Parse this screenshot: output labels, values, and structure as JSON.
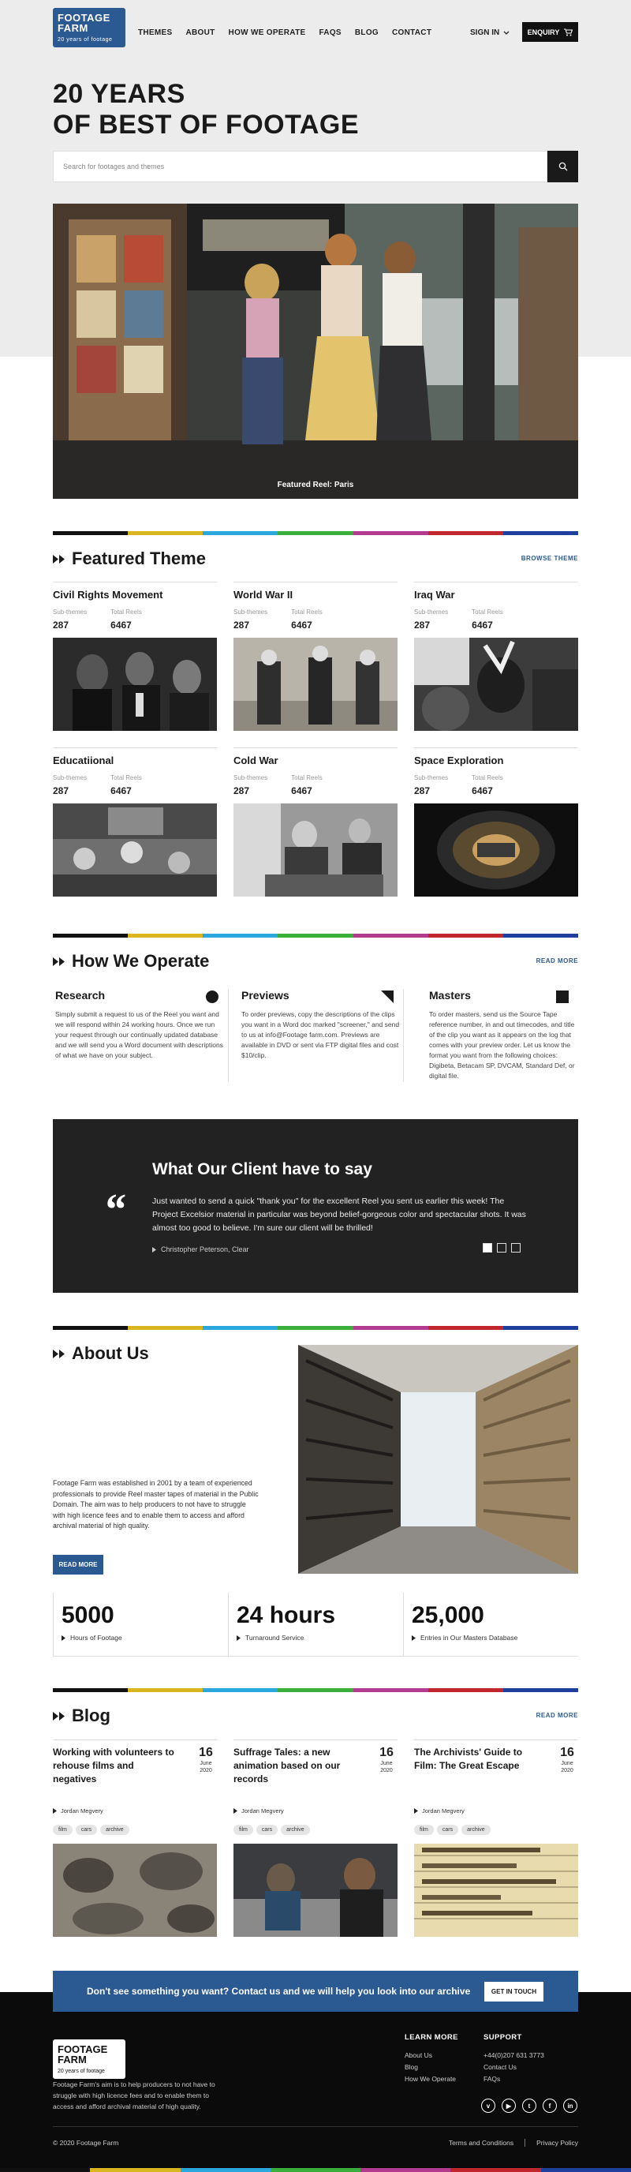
{
  "header": {
    "logo_line1": "FOOTAGE",
    "logo_line2": "FARM",
    "logo_tag": "20 years of footage",
    "nav": [
      "THEMES",
      "ABOUT",
      "HOW WE OPERATE",
      "FAQS",
      "BLOG",
      "CONTACT"
    ],
    "signin": "SIGN IN",
    "enquiry": "ENQUIRY"
  },
  "hero": {
    "title_line1": "20 YEARS",
    "title_line2": "OF BEST OF FOOTAGE",
    "search_placeholder": "Search for footages and themes",
    "caption": "Featured Reel: Paris"
  },
  "stripe_colors": [
    "#111111",
    "#d9b620",
    "#2aa7dd",
    "#3aae3a",
    "#b23a8f",
    "#c0262b",
    "#1f3f9e"
  ],
  "featured": {
    "title": "Featured Theme",
    "link": "BROWSE THEME",
    "sub_label": "Sub-themes",
    "reels_label": "Total Reels",
    "themes": [
      {
        "name": "Civil Rights Movement",
        "sub": "287",
        "reels": "6467"
      },
      {
        "name": "World War II",
        "sub": "287",
        "reels": "6467"
      },
      {
        "name": "Iraq War",
        "sub": "287",
        "reels": "6467"
      },
      {
        "name": "Educatiional",
        "sub": "287",
        "reels": "6467"
      },
      {
        "name": "Cold War",
        "sub": "287",
        "reels": "6467"
      },
      {
        "name": "Space Exploration",
        "sub": "287",
        "reels": "6467"
      }
    ]
  },
  "operate": {
    "title": "How We Operate",
    "link": "READ MORE",
    "items": [
      {
        "title": "Research",
        "desc": "Simply submit a request to us of the Reel you want and we will respond within 24 working hours. Once we run your request through our continually updated database and we will send you a Word document with descriptions of what we have on your subject."
      },
      {
        "title": "Previews",
        "desc": "To order previews, copy the descriptions of the clips you want in a Word doc marked \"screener,\" and send to us at info@Footage farm.com. Previews are available in DVD or sent via FTP digital files and cost $10/clip."
      },
      {
        "title": "Masters",
        "desc": "To order masters, send us the Source Tape reference number, in and out timecodes, and title of the clip you want as it appears on the log that comes with your preview order. Let us know the format you want from the following choices: Digibeta, Betacam SP, DVCAM, Standard Def, or digital file."
      }
    ]
  },
  "testimonial": {
    "title": "What Our Client have to say",
    "quote": "Just wanted to send a quick \"thank you\" for the excellent Reel you sent us earlier this week! The Project Excelsior material in particular was beyond belief-gorgeous color and spectacular shots. It was almost too good to believe. I'm sure our client will be thrilled!",
    "author": "Christopher Peterson, Clear"
  },
  "about": {
    "title": "About Us",
    "text": "Footage Farm was established in 2001 by a team of experienced professionals to provide Reel master tapes of material in the Public Domain. The aim was to help producers to not have to struggle with high licence fees and to enable them to access and afford archival material of high quality.",
    "button": "READ MORE",
    "stats": [
      {
        "num": "5000",
        "label": "Hours of Footage"
      },
      {
        "num": "24 hours",
        "label": "Turnaround Service"
      },
      {
        "num": "25,000",
        "label": "Entries in Our Masters Database"
      }
    ]
  },
  "blog": {
    "title": "Blog",
    "link": "READ MORE",
    "posts": [
      {
        "title": "Working with volunteers to rehouse films and negatives",
        "day": "16",
        "month": "June",
        "year": "2020",
        "author": "Jordan Megvery",
        "tags": [
          "film",
          "cars",
          "archive"
        ]
      },
      {
        "title": "Suffrage Tales: a new animation based on our records",
        "day": "16",
        "month": "June",
        "year": "2020",
        "author": "Jordan Megvery",
        "tags": [
          "film",
          "cars",
          "archive"
        ]
      },
      {
        "title": "The Archivists' Guide to Film: The Great Escape",
        "day": "16",
        "month": "June",
        "year": "2020",
        "author": "Jordan Megvery",
        "tags": [
          "film",
          "cars",
          "archive"
        ]
      }
    ]
  },
  "cta": {
    "text": "Don't see something you want? Contact us and we will help you look into our archive",
    "button": "GET IN TOUCH"
  },
  "footer": {
    "text": "Footage Farm's aim is to help producers to not have to struggle with high licence fees and to enable them to access and afford archival material of high quality.",
    "learn_title": "LEARN MORE",
    "learn": [
      "About Us",
      "Blog",
      "How We Operate"
    ],
    "support_title": "SUPPORT",
    "support": [
      "+44(0)207 631 3773",
      "Contact Us",
      "FAQs"
    ],
    "social": [
      "v",
      "▶",
      "t",
      "f",
      "in"
    ],
    "copyright": "© 2020 Footage Farm",
    "terms": "Terms and Conditions",
    "privacy": "Privacy Policy"
  }
}
